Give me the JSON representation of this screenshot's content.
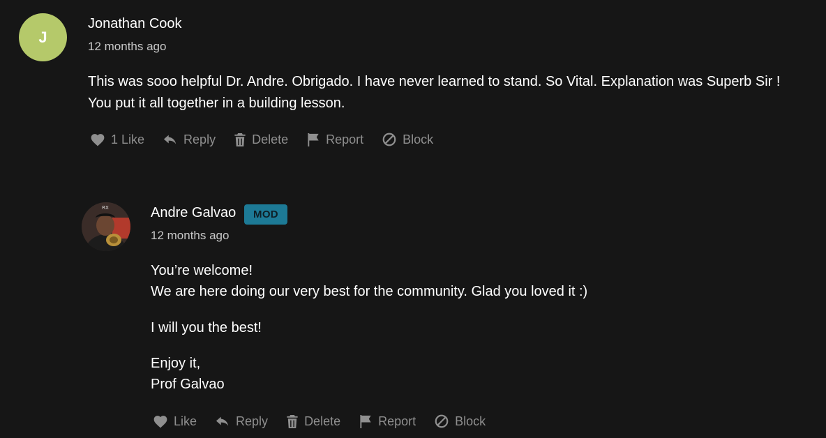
{
  "comments": [
    {
      "avatar_letter": "J",
      "avatar_color": "#b5c96a",
      "author": "Jonathan Cook",
      "time": "12 months ago",
      "body": [
        "This was sooo helpful Dr. Andre. Obrigado. I have never learned to stand. So Vital. Explanation was Superb Sir !",
        "You put it all together in a building lesson."
      ],
      "actions": {
        "like": "1 Like",
        "reply": "Reply",
        "delete": "Delete",
        "report": "Report",
        "block": "Block"
      }
    },
    {
      "author": "Andre Galvao",
      "badge": "MOD",
      "badge_color": "#1d7a96",
      "time": "12 months ago",
      "body": [
        "You’re welcome!",
        "We are here doing our very best for the community. Glad you loved it :)",
        "I will you the best!",
        "Enjoy it,",
        "Prof Galvao"
      ],
      "actions": {
        "like": "Like",
        "reply": "Reply",
        "delete": "Delete",
        "report": "Report",
        "block": "Block"
      }
    }
  ],
  "icons": [
    "heart-icon",
    "reply-arrow-icon",
    "trash-icon",
    "flag-icon",
    "block-icon"
  ]
}
